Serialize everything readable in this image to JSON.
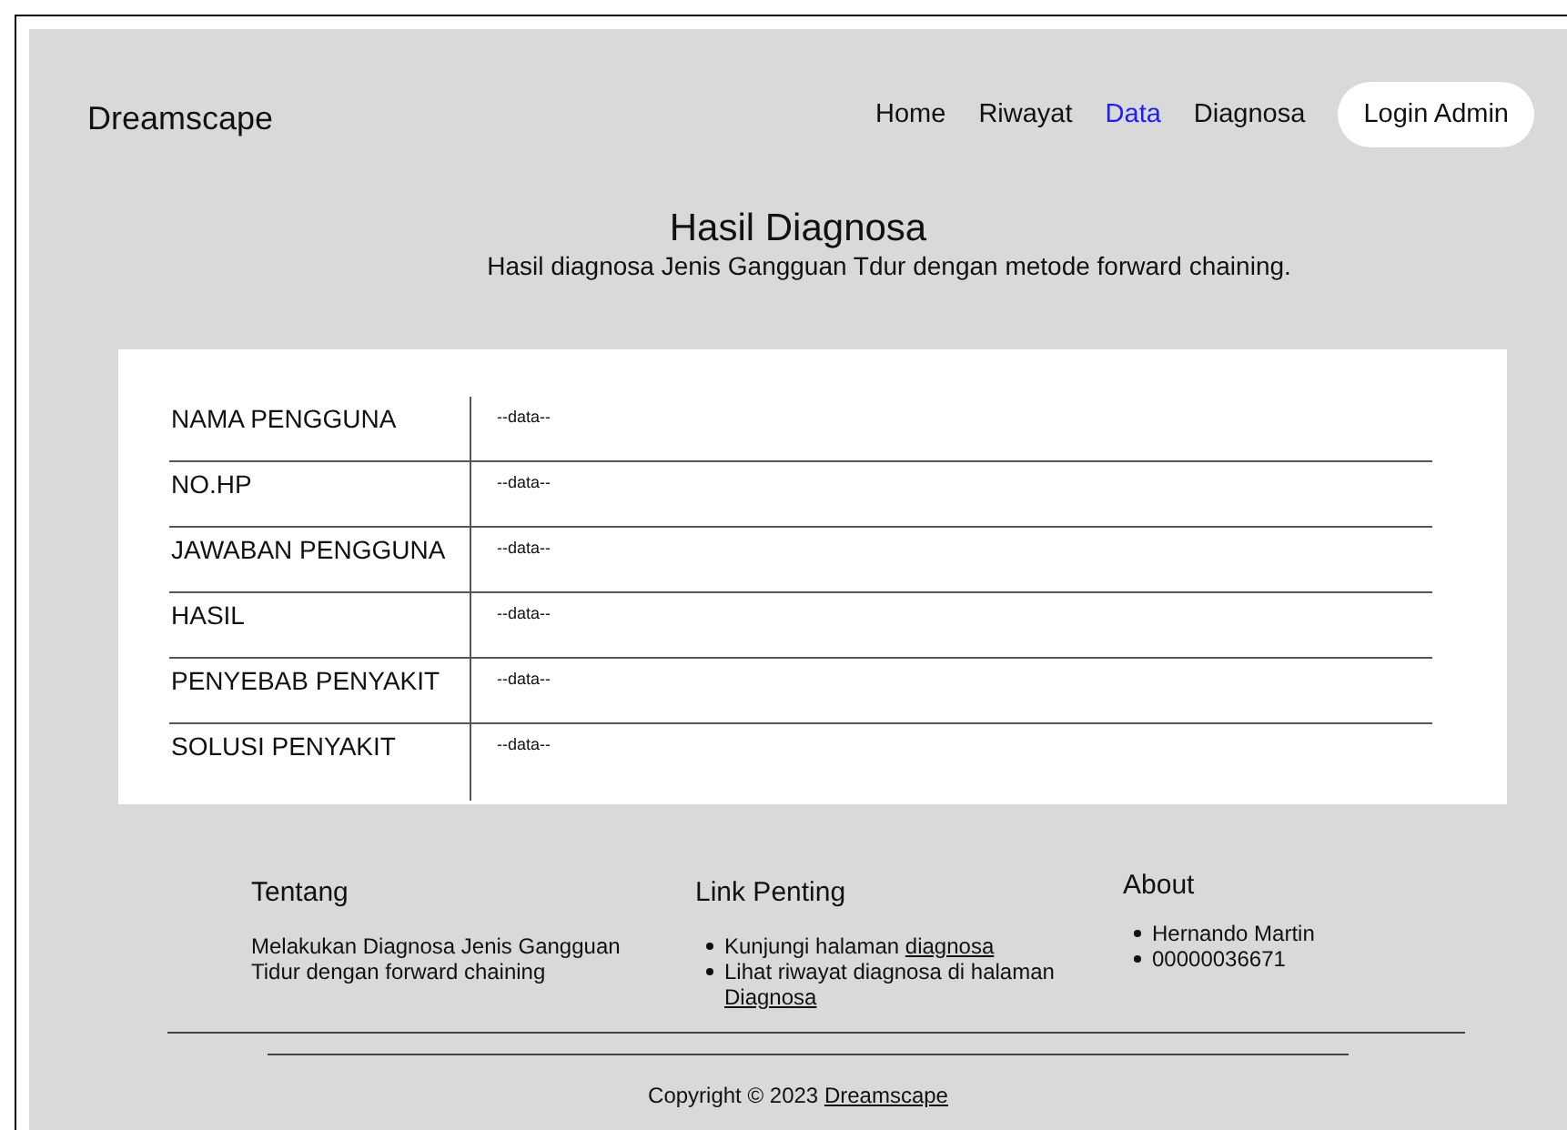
{
  "brand": "Dreamscape",
  "nav": [
    {
      "label": "Home",
      "selected": false
    },
    {
      "label": "Riwayat",
      "selected": false
    },
    {
      "label": "Data",
      "selected": true
    },
    {
      "label": "Diagnosa",
      "selected": false
    }
  ],
  "login_button": "Login Admin",
  "heading": {
    "title": "Hasil Diagnosa",
    "subtitle": "Hasil diagnosa Jenis Gangguan Tdur dengan metode forward chaining."
  },
  "table": {
    "rows": [
      {
        "label": "NAMA PENGGUNA",
        "value": "--data--"
      },
      {
        "label": "NO.HP",
        "value": "--data--"
      },
      {
        "label": "JAWABAN PENGGUNA",
        "value": "--data--"
      },
      {
        "label": "HASIL",
        "value": "--data--"
      },
      {
        "label": "PENYEBAB PENYAKIT",
        "value": "--data--"
      },
      {
        "label": "SOLUSI PENYAKIT",
        "value": "--data--"
      }
    ]
  },
  "footer": {
    "about_title": "Tentang",
    "about_text": "Melakukan Diagnosa Jenis Gangguan Tidur dengan forward chaining",
    "links_title": "Link Penting",
    "links": [
      {
        "text": "Kunjungi halaman ",
        "link": "diagnosa"
      },
      {
        "text": "Lihat riwayat diagnosa di halaman ",
        "link": "Diagnosa"
      }
    ],
    "author_title": "About",
    "author": [
      "Hernando Martin",
      "00000036671"
    ],
    "copyright": "Copyright © 2023",
    "copyright_link": "Dreamscape"
  }
}
